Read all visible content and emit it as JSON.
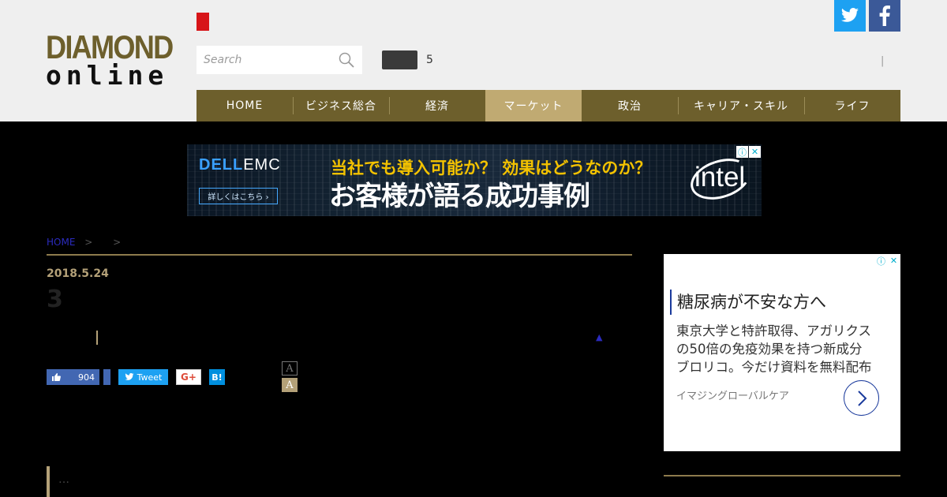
{
  "header": {
    "logo": {
      "top": "DIAMOND",
      "bottom": "online"
    },
    "search": {
      "placeholder": "Search"
    },
    "count": "5",
    "separator": "|"
  },
  "nav": {
    "items": [
      {
        "label": "HOME"
      },
      {
        "label": "ビジネス総合"
      },
      {
        "label": "経済"
      },
      {
        "label": "マーケット"
      },
      {
        "label": "政治"
      },
      {
        "label": "キャリア・スキル"
      },
      {
        "label": "ライフ"
      }
    ]
  },
  "banner": {
    "brand_prefix": "DELL",
    "brand_suffix": "EMC",
    "button": "詳しくはこちら ›",
    "line1": "当社でも導入可能か？ 効果はどうなのか？",
    "line2": "お客様が語る成功事例",
    "partner": "intel"
  },
  "breadcrumb": {
    "home": "HOME",
    "sep1": ">",
    "sep2": ">"
  },
  "article": {
    "date": "2018.5.24",
    "number": "3",
    "triangle": "▲",
    "ellipsis": "…"
  },
  "share": {
    "like_count": "904",
    "tweet_label": "Tweet",
    "gplus_label": "G+",
    "hatena_label": "B!",
    "font_small": "A",
    "font_large": "A"
  },
  "side_ad": {
    "title": "糖尿病が不安な方へ",
    "body": [
      "東京大学と特許取得、アガリクス",
      "の50倍の免疫効果を持つ新成分",
      "ブロリコ。今だけ資料を無料配布"
    ],
    "brand": "イマジングローバルケア"
  },
  "colors": {
    "brand_gold": "#6d5f2c",
    "nav_active": "#c0aa72",
    "accent_gold": "#b4a178",
    "twitter": "#1da1f2",
    "facebook": "#3b5998"
  },
  "icons": [
    "search-icon",
    "twitter-icon",
    "facebook-icon",
    "ad-info-icon",
    "ad-close-icon",
    "chevron-right-icon"
  ]
}
